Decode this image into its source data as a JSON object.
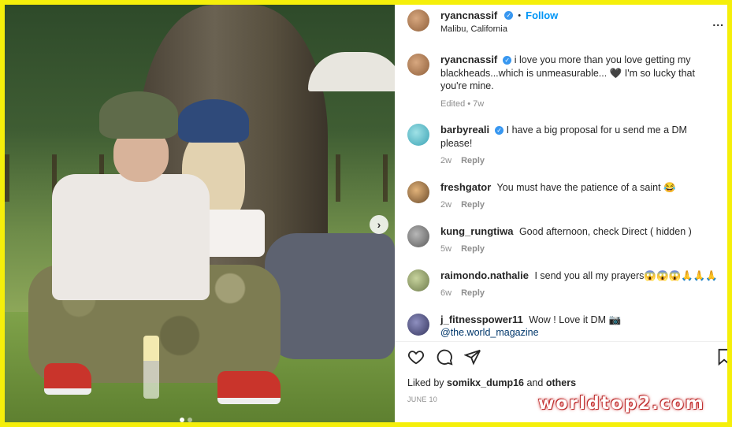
{
  "post": {
    "username": "ryancnassif",
    "follow_label": "Follow",
    "separator": "•",
    "location": "Malibu, California",
    "more_label": "..."
  },
  "comments": [
    {
      "username": "ryancnassif",
      "text": "i love you more than you love getting my blackheads...which is unmeasurable... 🖤 I'm so lucky that you're mine.",
      "time": "Edited • 7w",
      "reply": "",
      "verified": true
    },
    {
      "username": "barbyreali",
      "text": "I have a big proposal for u send me a DM please!",
      "time": "2w",
      "reply": "Reply",
      "verified": true
    },
    {
      "username": "freshgator",
      "text": "You must have the patience of a saint 😂",
      "time": "2w",
      "reply": "Reply",
      "verified": false
    },
    {
      "username": "kung_rungtiwa",
      "text": "Good afternoon, check Direct ( hidden )",
      "time": "5w",
      "reply": "Reply",
      "verified": false
    },
    {
      "username": "raimondo.nathalie",
      "text": "I send you all my prayers😱😱😱🙏🙏🙏",
      "time": "6w",
      "reply": "Reply",
      "verified": false
    },
    {
      "username": "j_fitnesspower11",
      "text": "Wow ! Love it DM 📷",
      "mention": "@the.world_magazine",
      "verified": false
    }
  ],
  "likes": {
    "prefix": "Liked by",
    "user": "somikx_dump16",
    "and": "and",
    "others": "others"
  },
  "date": "JUNE 10",
  "watermark": "worldtop2.com",
  "colors": {
    "border": "#f5ef0a",
    "follow": "#0095f6",
    "verified": "#3897f0"
  }
}
